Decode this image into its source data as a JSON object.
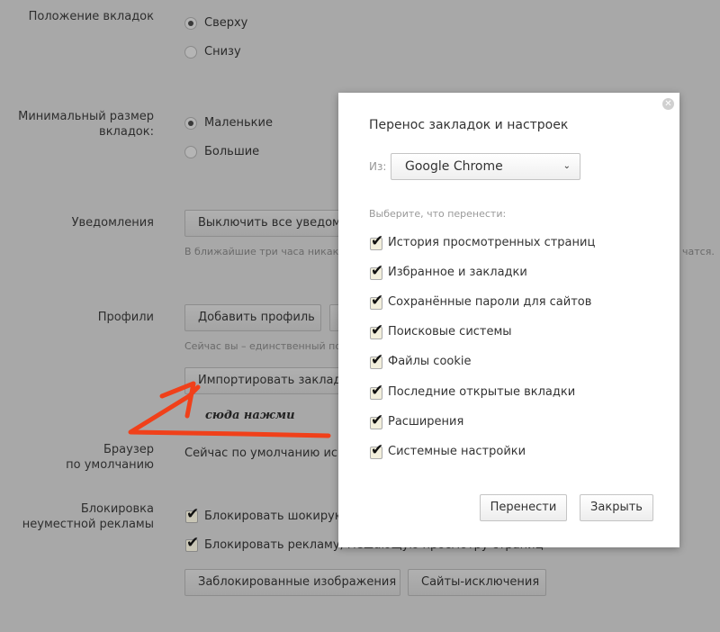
{
  "settings": {
    "tabs_position": {
      "label": "Положение вкладок",
      "options": [
        "Сверху",
        "Снизу"
      ],
      "selected": "Сверху"
    },
    "min_tab_size": {
      "label_line1": "Минимальный размер",
      "label_line2": "вкладок:",
      "options": [
        "Маленькие",
        "Большие"
      ],
      "selected": "Маленькие"
    },
    "notifications": {
      "label": "Уведомления",
      "button": "Выключить все уведомл",
      "hint_left": "В ближайшие три часа никаки",
      "hint_right": "чатся."
    },
    "profiles": {
      "label": "Профили",
      "add_button": "Добавить профиль",
      "hint": "Сейчас вы – единственный по",
      "import_button": "Импортировать закладк"
    },
    "annotation": "сюда нажми",
    "default_browser": {
      "label_line1": "Браузер",
      "label_line2": "по умолчанию",
      "text": "Сейчас по умолчанию исп"
    },
    "ad_block": {
      "label_line1": "Блокировка",
      "label_line2": "неуместной рекламы",
      "checks": [
        {
          "label": "Блокировать шокирую",
          "checked": true
        },
        {
          "label": "Блокировать рекламу, мешающую просмотру страниц",
          "checked": true
        }
      ],
      "buttons": [
        "Заблокированные изображения",
        "Сайты-исключения"
      ]
    }
  },
  "dialog": {
    "title": "Перенос закладок и настроек",
    "from_label": "Из:",
    "from_value": "Google Chrome",
    "choose_label": "Выберите, что перенести:",
    "items": [
      {
        "label": "История просмотренных страниц",
        "checked": true
      },
      {
        "label": "Избранное и закладки",
        "checked": true
      },
      {
        "label": "Сохранённые пароли для сайтов",
        "checked": true
      },
      {
        "label": "Поисковые системы",
        "checked": true
      },
      {
        "label": "Файлы cookie",
        "checked": true
      },
      {
        "label": "Последние открытые вкладки",
        "checked": true
      },
      {
        "label": "Расширения",
        "checked": true
      },
      {
        "label": "Системные настройки",
        "checked": true
      }
    ],
    "transfer_button": "Перенести",
    "close_button": "Закрыть"
  },
  "colors": {
    "annotation_arrow": "#f0401a"
  }
}
